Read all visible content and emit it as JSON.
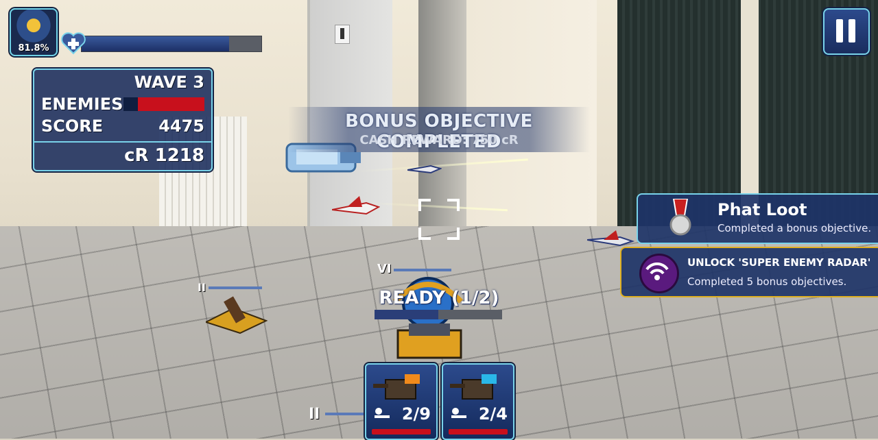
{
  "player": {
    "avatar_percent": "81.8%",
    "health_fraction": 0.82
  },
  "stats": {
    "wave": "WAVE 3",
    "enemies_label": "ENEMIES",
    "enemies_fraction": 0.82,
    "score_label": "SCORE",
    "score_value": "4475",
    "credits": "cR 1218"
  },
  "bonus": {
    "title": "BONUS OBJECTIVE COMPLETED",
    "subtitle": "CASH REWARD: 750 cR"
  },
  "achievement": {
    "title": "Phat Loot",
    "description": "Completed a bonus objective."
  },
  "unlock": {
    "title": "UNLOCK 'SUPER ENEMY RADAR'",
    "description": "Completed 5 bonus objectives."
  },
  "tower": {
    "level": "VI",
    "ready_text": "READY (1/2)",
    "ready_fraction": 0.5
  },
  "left_turret_level": "II",
  "bottom_turret_level": "II",
  "cards": [
    {
      "count": "2/9",
      "accent": "#f08a1c"
    },
    {
      "count": "2/4",
      "accent": "#2ab8e8"
    }
  ],
  "colors": {
    "hud_border": "#79d3ea",
    "hud_bg": "#1e3468",
    "enemy_bar": "#c8101c",
    "unlock_border": "#e0b020"
  },
  "icons": {
    "pause": "pause-icon",
    "health": "heart-plus-icon",
    "medal": "medal-icon",
    "radar": "radar-icon",
    "crosshair": "crosshair-icon"
  }
}
